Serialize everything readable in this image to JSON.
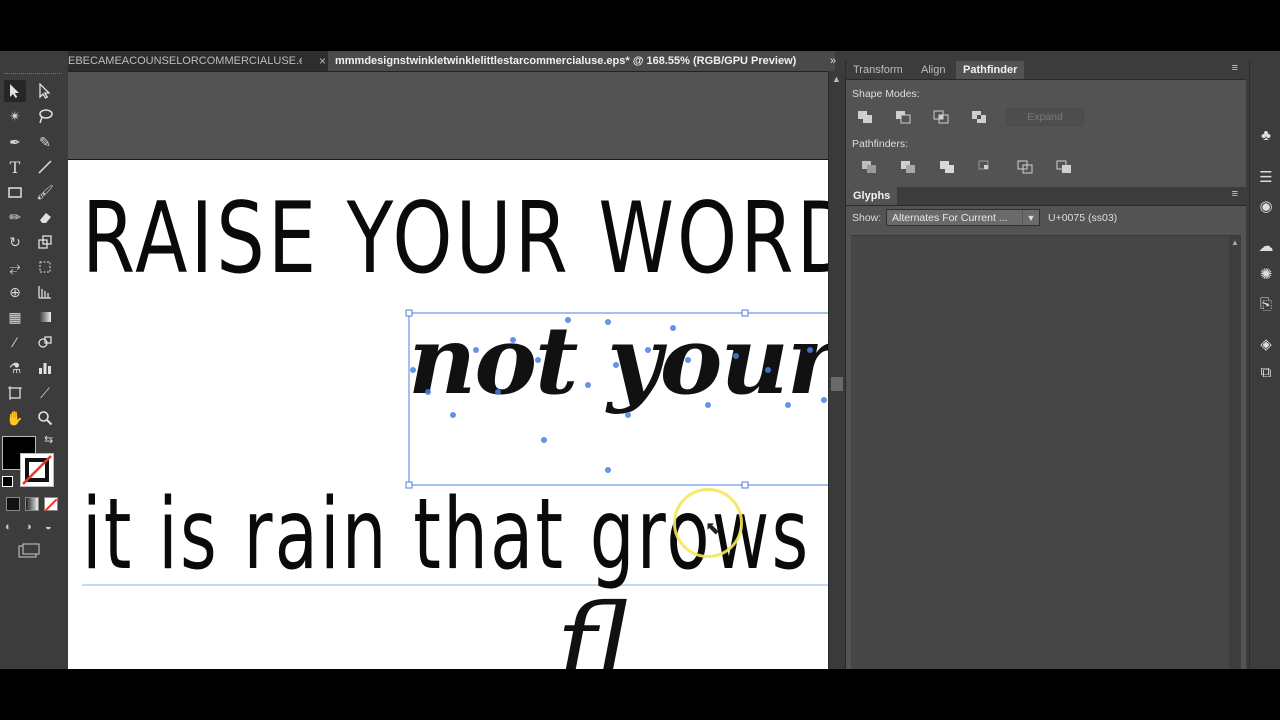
{
  "tabs": {
    "inactive_label": "EBECAMEACOUNSELORCOMMERCIALUSE.eps*",
    "active_label": "mmmdesignstwinkletwinklelittlestarcommercialuse.eps* @ 168.55% (RGB/GPU Preview)",
    "close_glyph": "×",
    "overflow_glyph": "»"
  },
  "artboard": {
    "line1": "RAISE YOUR WORDS",
    "script1": "not your",
    "line3": "it is rain that grows",
    "script2": "fl"
  },
  "panels": {
    "top_tabs": [
      "Transform",
      "Align",
      "Pathfinder"
    ],
    "active_top_tab": "Pathfinder",
    "shape_modes_label": "Shape Modes:",
    "expand_label": "Expand",
    "pathfinders_label": "Pathfinders:",
    "glyphs_tab": "Glyphs",
    "show_label": "Show:",
    "show_value": "Alternates For Current ...",
    "unicode_readout": "U+0075 (ss03)",
    "menu_glyph": "≡"
  },
  "colors": {
    "selection_blue": "#4a7fe0",
    "fill": "#000000",
    "stroke": "none",
    "cursor_highlight": "#f2e85a"
  },
  "icons": {
    "toolbar": [
      "selection-tool-icon",
      "direct-selection-tool-icon",
      "magic-wand-icon",
      "lasso-icon",
      "pen-tool-icon",
      "curvature-tool-icon",
      "type-tool-icon",
      "line-tool-icon",
      "rectangle-tool-icon",
      "paintbrush-icon",
      "pencil-icon",
      "eraser-icon",
      "rotate-tool-icon",
      "scale-tool-icon",
      "width-tool-icon",
      "free-transform-icon",
      "shape-builder-icon",
      "perspective-grid-icon",
      "mesh-tool-icon",
      "gradient-tool-icon",
      "eyedropper-icon",
      "blend-tool-icon",
      "symbol-sprayer-icon",
      "column-graph-icon",
      "artboard-tool-icon",
      "slice-tool-icon",
      "hand-tool-icon",
      "zoom-tool-icon"
    ],
    "strip": [
      "libraries-icon",
      "properties-icon",
      "appearance-icon",
      "cc-libraries-icon",
      "color-icon",
      "export-icon",
      "layers-icon",
      "artboards-icon"
    ]
  }
}
